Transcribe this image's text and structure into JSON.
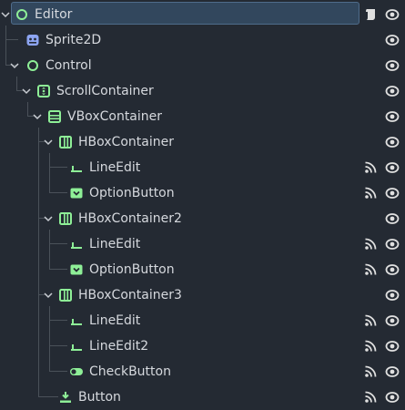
{
  "colors": {
    "background": "#242a33",
    "selection": "#32475d",
    "control_green": "#8eef97",
    "node2d_blue": "#8da5f3",
    "text": "#d6d9de",
    "icon_gray": "#d6d9de"
  },
  "tree": {
    "nodes": [
      {
        "label": "Editor",
        "icon": "control-icon",
        "selected": true,
        "expanded": true,
        "has_script": true
      },
      {
        "label": "Sprite2D",
        "icon": "sprite2d-icon"
      },
      {
        "label": "Control",
        "icon": "control-icon",
        "expanded": true
      },
      {
        "label": "ScrollContainer",
        "icon": "scroll-container-icon",
        "expanded": true
      },
      {
        "label": "VBoxContainer",
        "icon": "vbox-container-icon",
        "expanded": true
      },
      {
        "label": "HBoxContainer",
        "icon": "hbox-container-icon",
        "expanded": true
      },
      {
        "label": "LineEdit",
        "icon": "line-edit-icon",
        "has_signal": true
      },
      {
        "label": "OptionButton",
        "icon": "option-button-icon",
        "has_signal": true
      },
      {
        "label": "HBoxContainer2",
        "icon": "hbox-container-icon",
        "expanded": true
      },
      {
        "label": "LineEdit",
        "icon": "line-edit-icon",
        "has_signal": true
      },
      {
        "label": "OptionButton",
        "icon": "option-button-icon",
        "has_signal": true
      },
      {
        "label": "HBoxContainer3",
        "icon": "hbox-container-icon",
        "expanded": true
      },
      {
        "label": "LineEdit",
        "icon": "line-edit-icon",
        "has_signal": true
      },
      {
        "label": "LineEdit2",
        "icon": "line-edit-icon",
        "has_signal": true
      },
      {
        "label": "CheckButton",
        "icon": "check-button-icon",
        "has_signal": true
      },
      {
        "label": "Button",
        "icon": "button-icon",
        "has_signal": true
      }
    ]
  }
}
